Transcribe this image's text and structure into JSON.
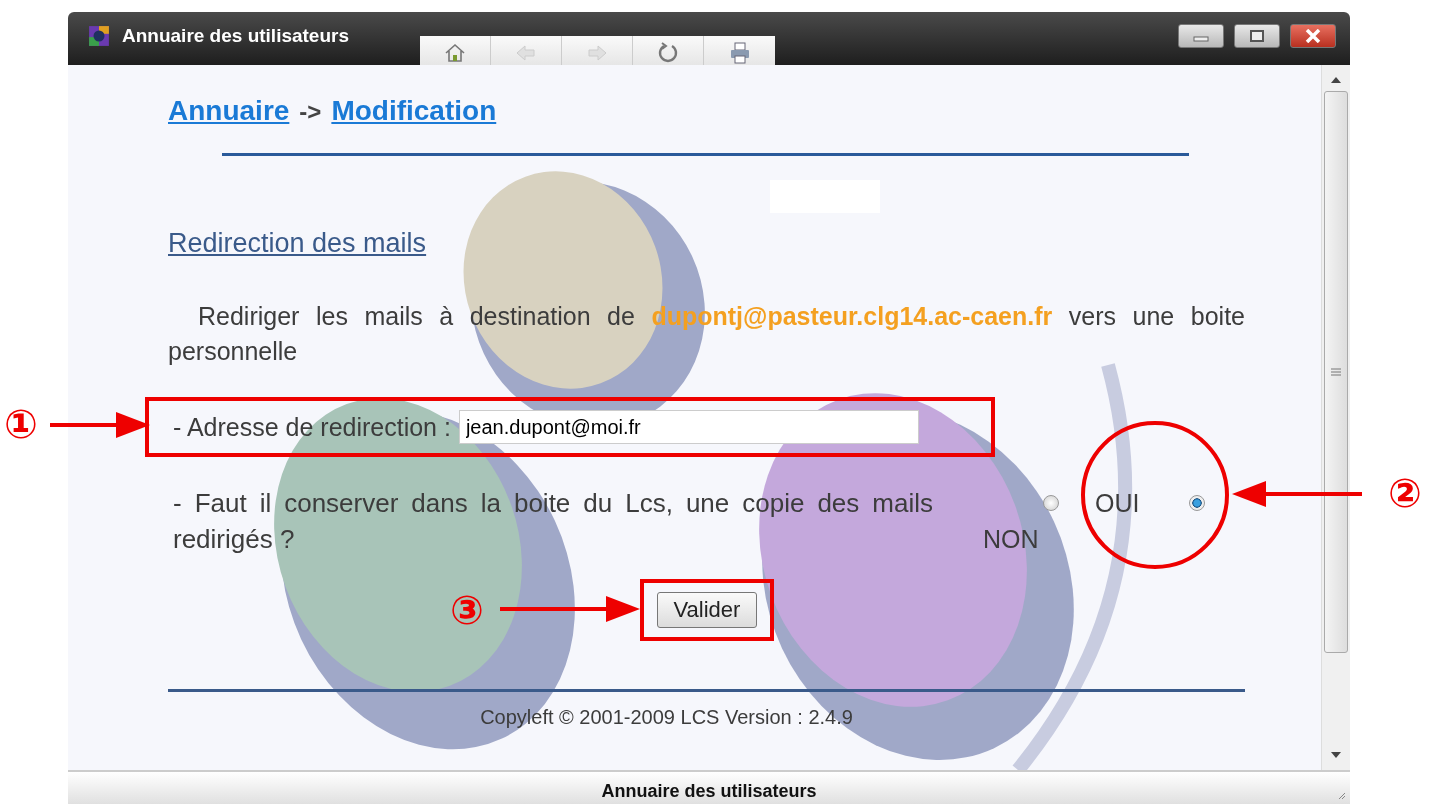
{
  "window": {
    "title": "Annuaire des utilisateurs"
  },
  "toolbar": [
    {
      "kind": "home",
      "disabled": false
    },
    {
      "kind": "back",
      "disabled": true
    },
    {
      "kind": "forward",
      "disabled": true
    },
    {
      "kind": "reload",
      "disabled": false
    },
    {
      "kind": "print",
      "disabled": false
    }
  ],
  "breadcrumb": {
    "links": [
      "Annuaire",
      "Modification"
    ],
    "separator": "->"
  },
  "section_title": "Redirection des mails",
  "intro": "Rediriger les mails à destination de **dupontj@pasteur.clg14.ac-caen.fr** vers une boite personnelle",
  "field": {
    "label": "- Adresse de redirection :",
    "value": "jean.dupont@moi.fr"
  },
  "question": "- Faut il conserver dans la boite du Lcs, une copie des mails redirigés ?",
  "options": [
    {
      "label": "OUI",
      "selected": false
    },
    {
      "label": "NON",
      "selected": true
    }
  ],
  "button": "Valider",
  "footer": "Copyleft © 2001-2009 LCS Version : 2.4.9",
  "status_bar": "Annuaire des utilisateurs",
  "annotations": [
    "①",
    "②",
    "③"
  ]
}
